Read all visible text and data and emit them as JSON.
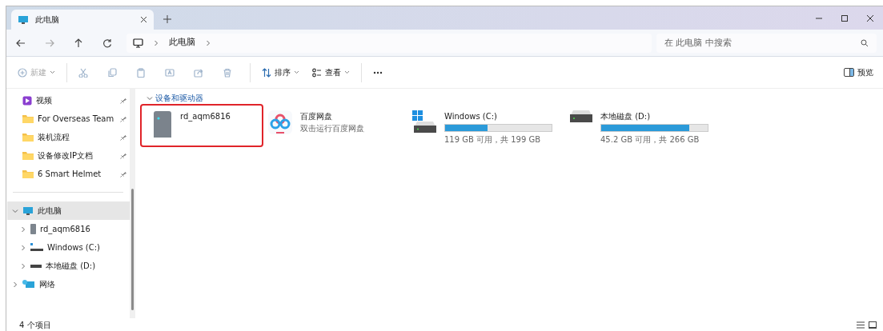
{
  "window": {
    "tab": {
      "title": "此电脑",
      "selected": true
    }
  },
  "address": {
    "crumbs": [
      "此电脑"
    ]
  },
  "search": {
    "placeholder": "在 此电脑 中搜索"
  },
  "toolbar": {
    "buttons": [
      {
        "kind": "new",
        "label": "新建",
        "disabled": true
      },
      {
        "kind": "cut",
        "disabled": true
      },
      {
        "kind": "copy",
        "disabled": true
      },
      {
        "kind": "paste",
        "disabled": true
      },
      {
        "kind": "rename",
        "disabled": true
      },
      {
        "kind": "share",
        "disabled": true
      },
      {
        "kind": "delete",
        "disabled": true
      },
      {
        "kind": "sort",
        "label": "排序",
        "disabled": false
      },
      {
        "kind": "view",
        "label": "查看",
        "disabled": false
      },
      {
        "kind": "more",
        "disabled": false
      }
    ],
    "preview": {
      "label": "预览"
    }
  },
  "sidebar": {
    "pinned": [
      {
        "kind": "video",
        "label": "视频"
      },
      {
        "kind": "folder",
        "label": "For Overseas Team"
      },
      {
        "kind": "folder",
        "label": "装机流程"
      },
      {
        "kind": "folder",
        "label": "设备修改IP文档"
      },
      {
        "kind": "folder",
        "label": "6 Smart Helmet"
      }
    ],
    "tree": [
      {
        "kind": "pc",
        "label": "此电脑",
        "expanded": true,
        "selected": true,
        "children": [
          {
            "kind": "device",
            "label": "rd_aqm6816",
            "expanded": false,
            "selected": false
          },
          {
            "kind": "windows",
            "label": "Windows (C:)",
            "expanded": false,
            "selected": false
          },
          {
            "kind": "disk",
            "label": "本地磁盘 (D:)",
            "expanded": false,
            "selected": false
          }
        ]
      },
      {
        "kind": "network",
        "label": "网络",
        "expanded": false,
        "selected": false
      }
    ]
  },
  "content": {
    "group": {
      "title": "设备和驱动器",
      "expanded": true
    },
    "items": [
      {
        "kind": "device",
        "name": "rd_aqm6816",
        "highlighted": true
      },
      {
        "kind": "app",
        "name": "百度网盘",
        "subtitle": "双击运行百度网盘",
        "highlighted": false
      },
      {
        "kind": "windows",
        "name": "Windows (C:)",
        "level": 0.4,
        "reading": "119 GB 可用，共 199 GB",
        "highlighted": false
      },
      {
        "kind": "disk",
        "name": "本地磁盘 (D:)",
        "level": 0.83,
        "reading": "45.2 GB 可用，共 266 GB",
        "highlighted": false
      }
    ]
  },
  "status_bar": {
    "count": "4 个项目"
  }
}
